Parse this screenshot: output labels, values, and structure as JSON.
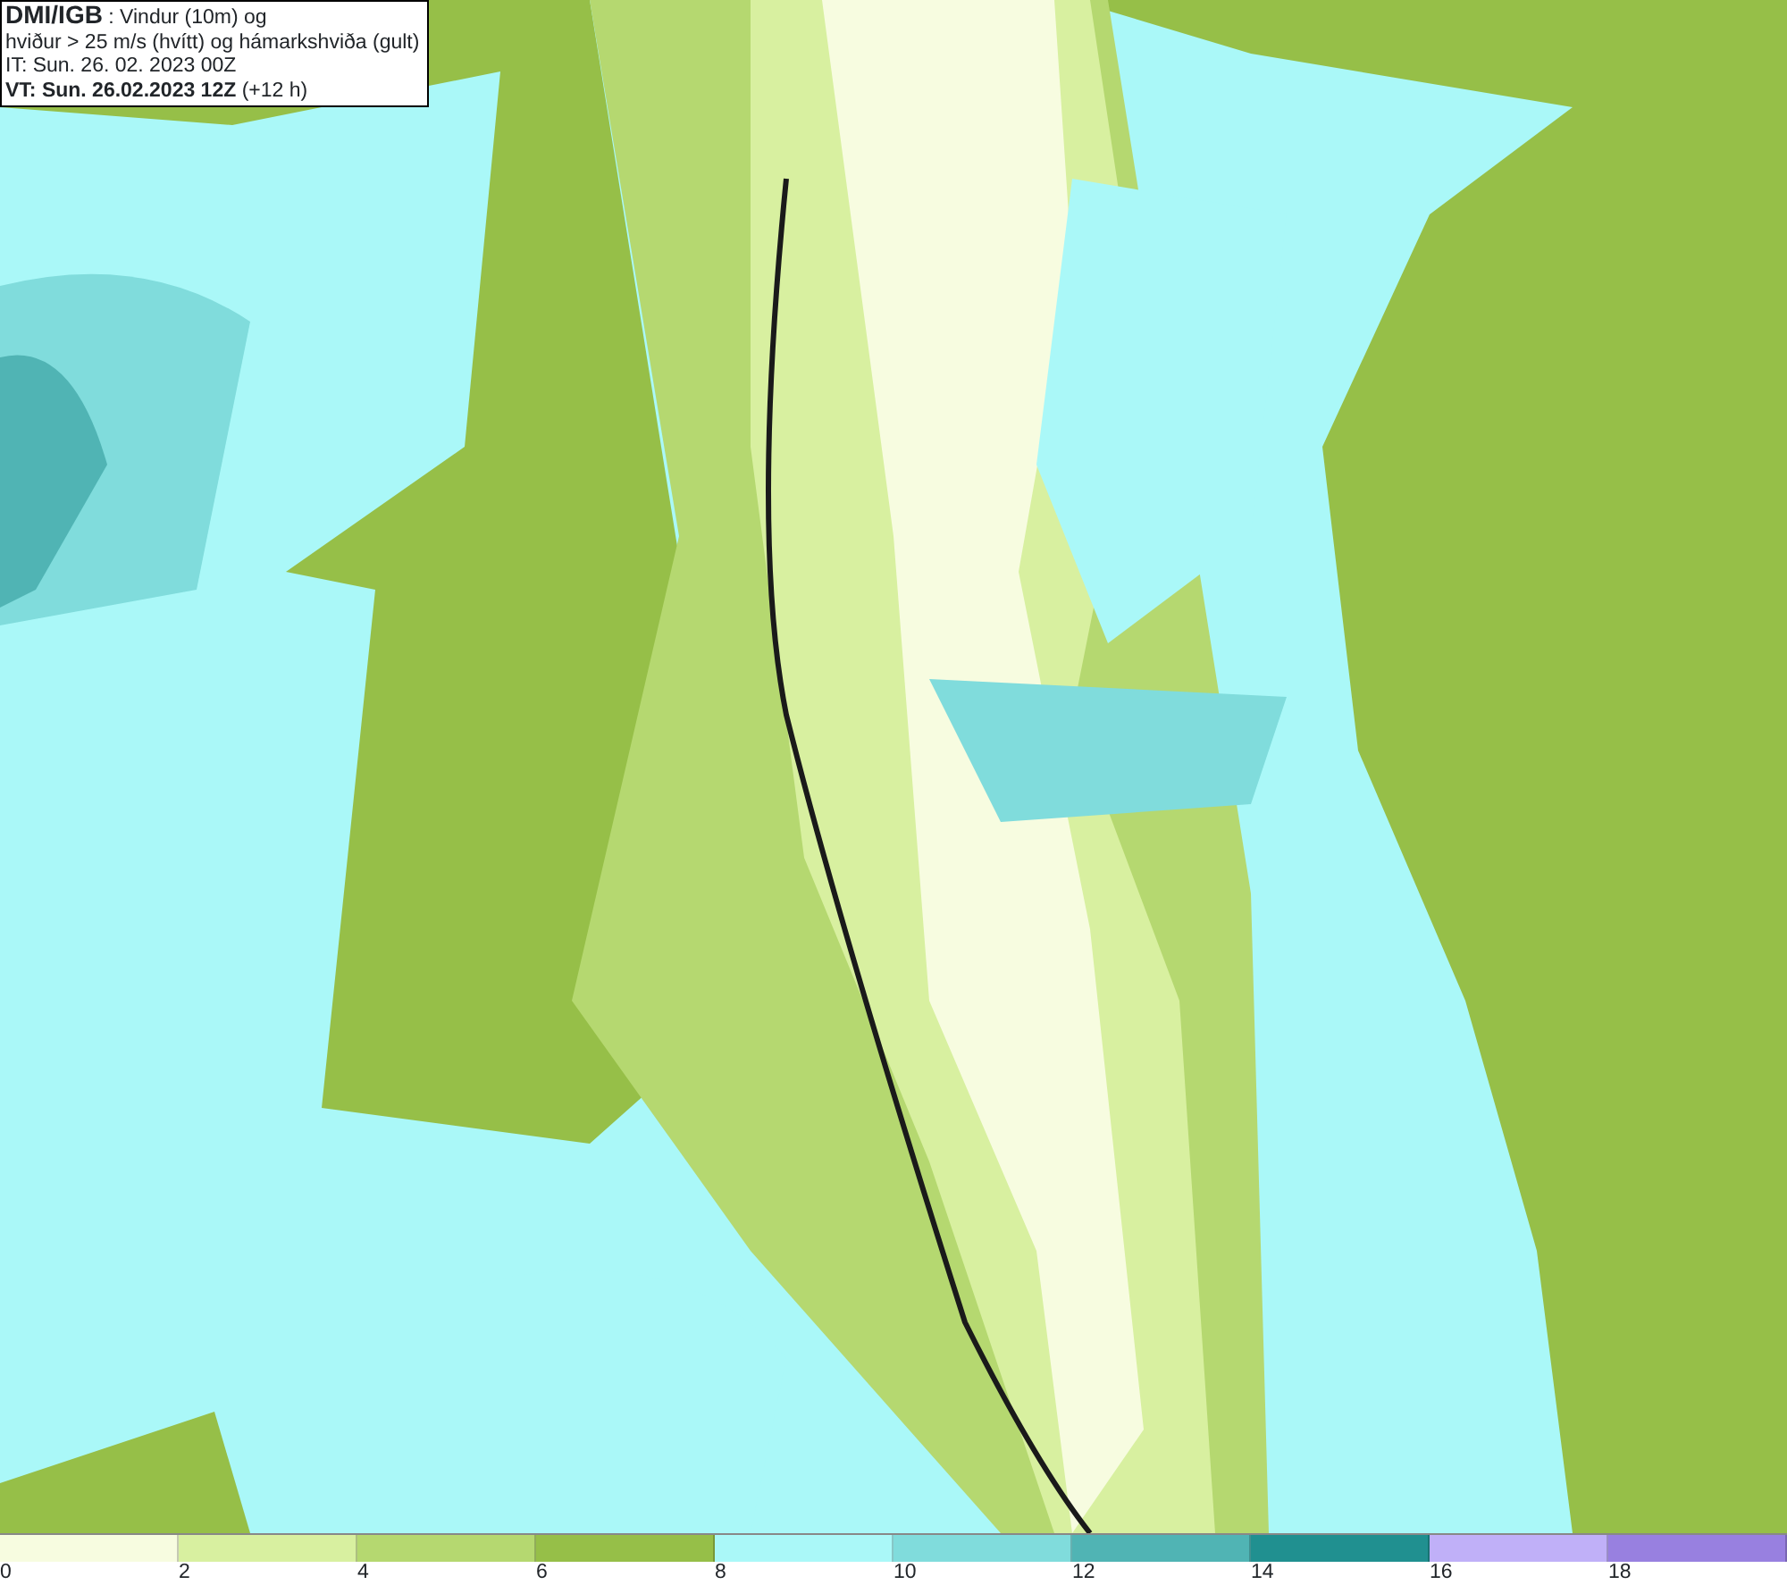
{
  "header": {
    "lines": [
      "**DMI/IGB** : Vindur (10m) og",
      "hviður > 25 m/s (hvítt) og hámarkshviða (gult)",
      "IT: Sun. 26. 02. 2023 00Z",
      "**VT: Sun. 26.02.2023 12Z** (+12 h)"
    ]
  },
  "legend": {
    "bins": [
      {
        "color": "#f7fce0",
        "label": "0"
      },
      {
        "color": "#d8f0a0",
        "label": "2"
      },
      {
        "color": "#b5d870",
        "label": "4"
      },
      {
        "color": "#96bf48",
        "label": "6"
      },
      {
        "color": "#aaf8f8",
        "label": "8"
      },
      {
        "color": "#80dcdc",
        "label": "10"
      },
      {
        "color": "#50b4b4",
        "label": "12"
      },
      {
        "color": "#209090",
        "label": "14"
      },
      {
        "color": "#c0b0f8",
        "label": "16"
      },
      {
        "color": "#9880e0",
        "label": "18"
      }
    ]
  }
}
